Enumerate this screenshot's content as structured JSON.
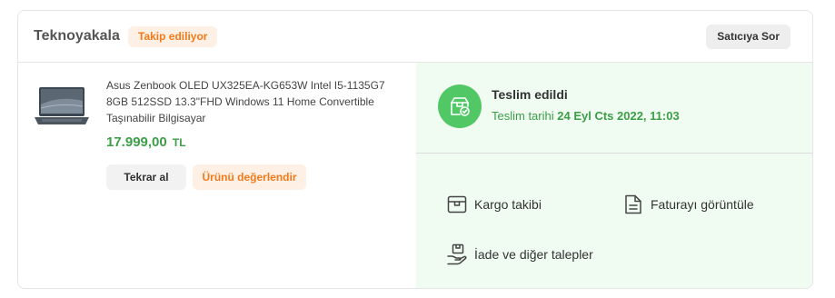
{
  "seller": {
    "name": "Teknoyakala",
    "follow_badge": "Takip ediliyor",
    "ask_button": "Satıcıya Sor"
  },
  "product": {
    "title": "Asus Zenbook OLED UX325EA-KG653W Intel I5-1135G7 8GB 512SSD 13.3\"FHD Windows 11 Home Convertible Taşınabilir Bilgisayar",
    "price": "17.999,00",
    "currency": "TL",
    "image_icon": "laptop-image",
    "buy_again_label": "Tekrar al",
    "review_label": "Ürünü değerlendir"
  },
  "delivery": {
    "status_title": "Teslim edildi",
    "date_label": "Teslim tarihi",
    "date_value": "24 Eyl Cts 2022, 11:03",
    "status_icon": "delivered-box-icon"
  },
  "actions": {
    "cargo_label": "Kargo takibi",
    "invoice_label": "Faturayı görüntüle",
    "return_label": "İade ve diğer talepler"
  },
  "colors": {
    "accent_orange": "#f27a1a",
    "badge_bg": "#fff0e5",
    "success_green": "#52c766",
    "price_green": "#3c9f48",
    "panel_green_bg": "#f0fbf1"
  }
}
